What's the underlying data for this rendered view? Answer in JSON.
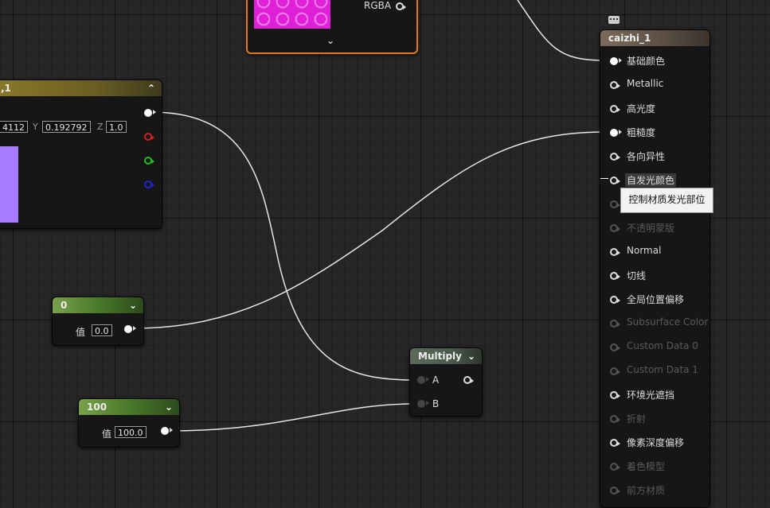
{
  "texture_node": {
    "output_label": "RGBA"
  },
  "constant3_node": {
    "title": ",1",
    "x_value": "4112",
    "y_label": "Y",
    "y_value": "0.192792",
    "z_label": "Z",
    "z_value": "1.0",
    "color_swatch": "#a77bff"
  },
  "const0_node": {
    "title": "0",
    "value_label": "值",
    "value": "0.0"
  },
  "const100_node": {
    "title": "100",
    "value_label": "值",
    "value": "100.0"
  },
  "multiply_node": {
    "title": "Multiply",
    "input_a": "A",
    "input_b": "B"
  },
  "material_node": {
    "title": "caizhi_1",
    "pins": [
      {
        "label": "基础颜色",
        "active": true
      },
      {
        "label": "Metallic",
        "active": true
      },
      {
        "label": "高光度",
        "active": true
      },
      {
        "label": "粗糙度",
        "active": true
      },
      {
        "label": "各向异性",
        "active": true
      },
      {
        "label": "自发光颜色",
        "active": true
      },
      {
        "label": "",
        "active": false
      },
      {
        "label": "不透明蒙版",
        "active": false
      },
      {
        "label": "Normal",
        "active": true
      },
      {
        "label": "切线",
        "active": true
      },
      {
        "label": "全局位置偏移",
        "active": true
      },
      {
        "label": "Subsurface Color",
        "active": false
      },
      {
        "label": "Custom Data 0",
        "active": false
      },
      {
        "label": "Custom Data 1",
        "active": false
      },
      {
        "label": "环境光遮挡",
        "active": true
      },
      {
        "label": "折射",
        "active": false
      },
      {
        "label": "像素深度偏移",
        "active": true
      },
      {
        "label": "着色模型",
        "active": false
      },
      {
        "label": "前方材质",
        "active": false
      }
    ]
  },
  "tooltip": {
    "text": "控制材质发光部位"
  },
  "colors": {
    "wire": "#e6e6e6",
    "texture_node_border": "#e07a1a",
    "texture_preview": "#e020d8"
  }
}
